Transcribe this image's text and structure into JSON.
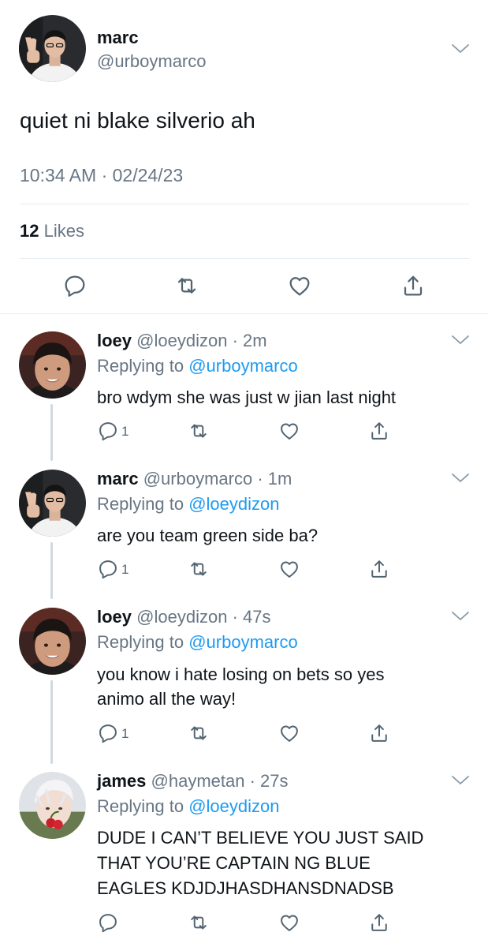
{
  "main_tweet": {
    "display_name": "marc",
    "handle": "@urboymarco",
    "text": "quiet ni blake silverio ah",
    "timestamp": "10:34 AM · 02/24/23",
    "likes_count": "12",
    "likes_label": "Likes"
  },
  "replies": [
    {
      "display_name": "loey",
      "handle": "@loeydizon",
      "time": "2m",
      "replying_prefix": "Replying to",
      "replying_to": "@urboymarco",
      "text_lines": [
        "bro wdym she was just w jian last night"
      ],
      "reply_count": "1"
    },
    {
      "display_name": "marc",
      "handle": "@urboymarco",
      "time": "1m",
      "replying_prefix": "Replying to",
      "replying_to": "@loeydizon",
      "text_lines": [
        "are you team green side ba?"
      ],
      "reply_count": "1"
    },
    {
      "display_name": "loey",
      "handle": "@loeydizon",
      "time": "47s",
      "replying_prefix": "Replying to",
      "replying_to": "@urboymarco",
      "text_lines": [
        "you know i hate losing on bets so yes",
        "animo all the way!"
      ],
      "reply_count": "1"
    },
    {
      "display_name": "james",
      "handle": "@haymetan",
      "time": "27s",
      "replying_prefix": "Replying to",
      "replying_to": "@loeydizon",
      "text_lines": [
        "DUDE I CAN’T BELIEVE YOU JUST SAID",
        "THAT YOU’RE CAPTAIN NG BLUE",
        "EAGLES KDJDJHASDHANSDNADSB"
      ],
      "reply_count": ""
    }
  ],
  "colors": {
    "link": "#1d9bf0",
    "muted": "#687684",
    "thread_line": "#cfd9de"
  }
}
